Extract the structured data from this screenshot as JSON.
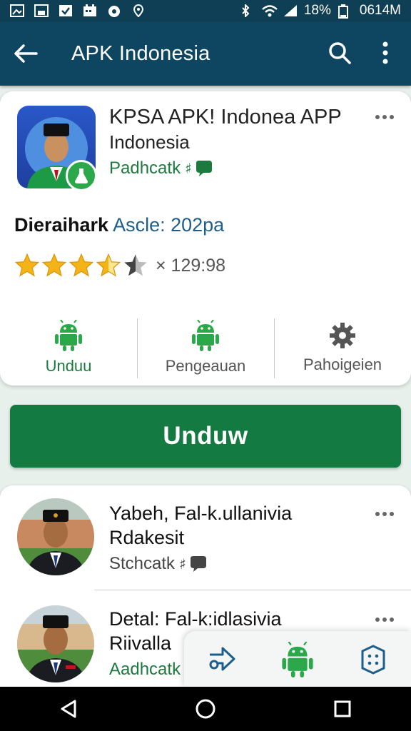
{
  "status_bar": {
    "battery_percent": "18%",
    "time": "0614M"
  },
  "app_bar": {
    "title": "APK Indonesia"
  },
  "app_card": {
    "name": "KPSA APK! Indonea APP",
    "developer": "Indonesia",
    "category": "Padhcatk",
    "meta_bold": "Dieraihark",
    "meta_blue": "Ascle: 202pa",
    "rating_stars": 3.5,
    "rating_count": "× 129:98",
    "actions": [
      {
        "label": "Unduu",
        "icon": "android-icon"
      },
      {
        "label": "Pengeauan",
        "icon": "android-icon"
      },
      {
        "label": "Pahoigeien",
        "icon": "gear-icon"
      }
    ]
  },
  "download_button": {
    "label": "Unduw"
  },
  "list": {
    "items": [
      {
        "name": "Yabeh, Fal-k.ullanivia",
        "sub": "Rdakesit",
        "category": "Stchcatk"
      },
      {
        "name": "Detal: Fal-k:idlasivia",
        "sub": "Riivalla",
        "category": "Aadhcatk"
      }
    ]
  },
  "colors": {
    "app_bar": "#0e4560",
    "accent_green": "#137a41",
    "link_blue": "#1d5f8a"
  }
}
